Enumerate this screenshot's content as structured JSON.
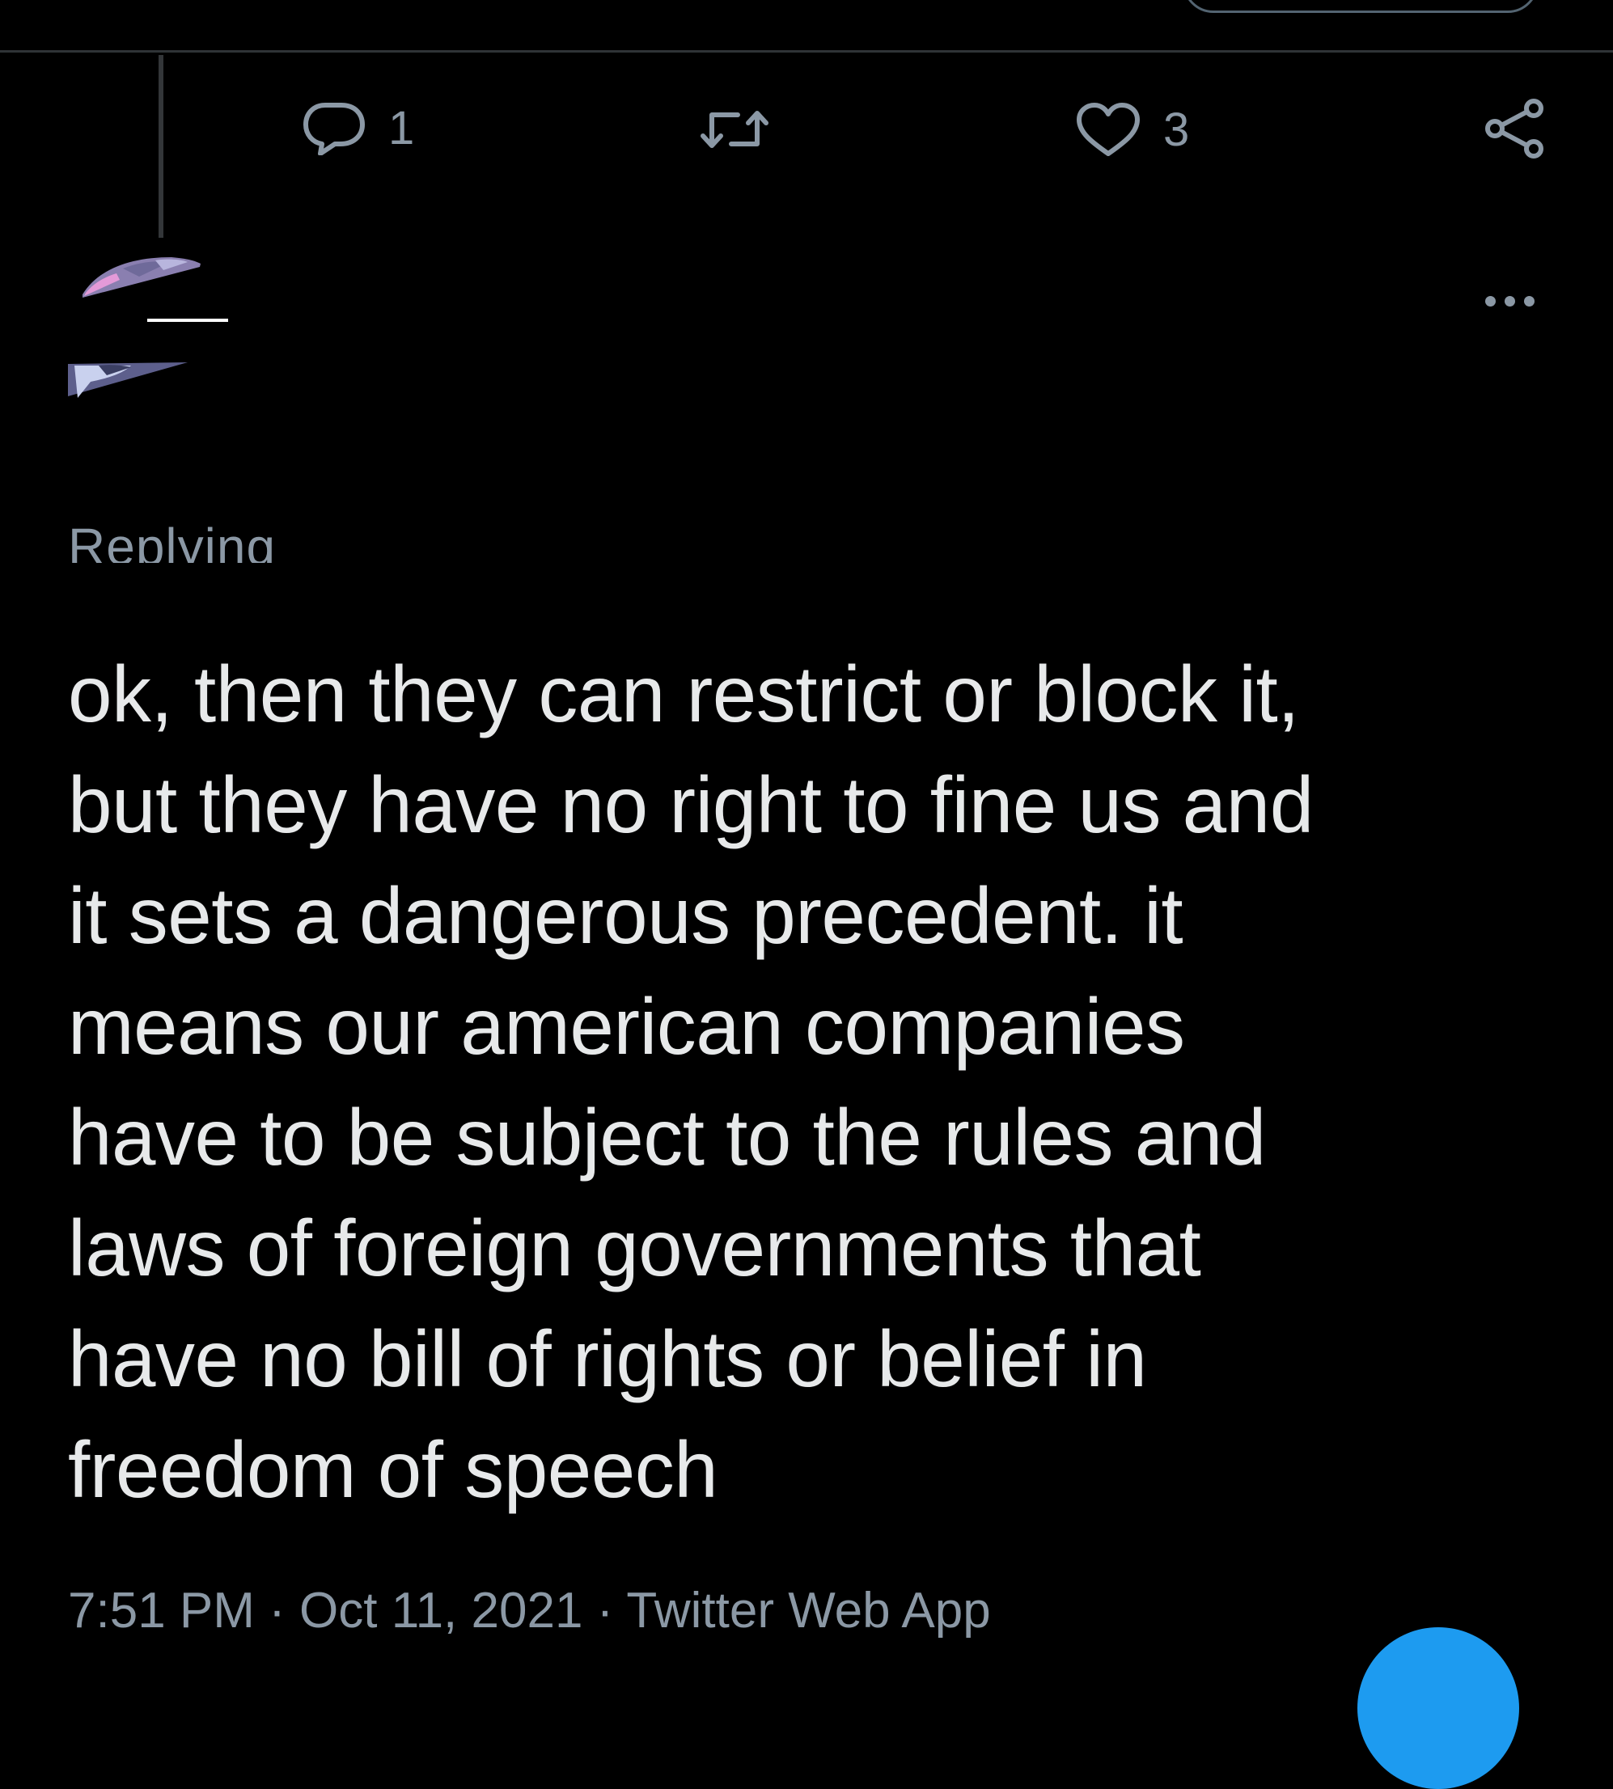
{
  "actions": {
    "reply": {
      "icon": "reply-icon",
      "count": "1"
    },
    "retweet": {
      "icon": "retweet-icon",
      "count": ""
    },
    "like": {
      "icon": "heart-icon",
      "count": "3"
    },
    "share": {
      "icon": "share-icon"
    }
  },
  "tweet": {
    "replying_label": "Replying",
    "more_icon": "more-icon",
    "text": "ok, then they can restrict or block it,\nbut they have no right to fine us and\nit sets a dangerous precedent. it\nmeans our american companies\nhave to be subject to the rules and\nlaws of foreign governments that\nhave no bill of rights or belief in\nfreedom of speech",
    "time": "7:51 PM",
    "date": "Oct 11, 2021",
    "source": "Twitter Web App"
  },
  "colors": {
    "background": "#000000",
    "text": "#e7e9ea",
    "muted": "#8b98a5",
    "accent": "#1d9bf0"
  }
}
